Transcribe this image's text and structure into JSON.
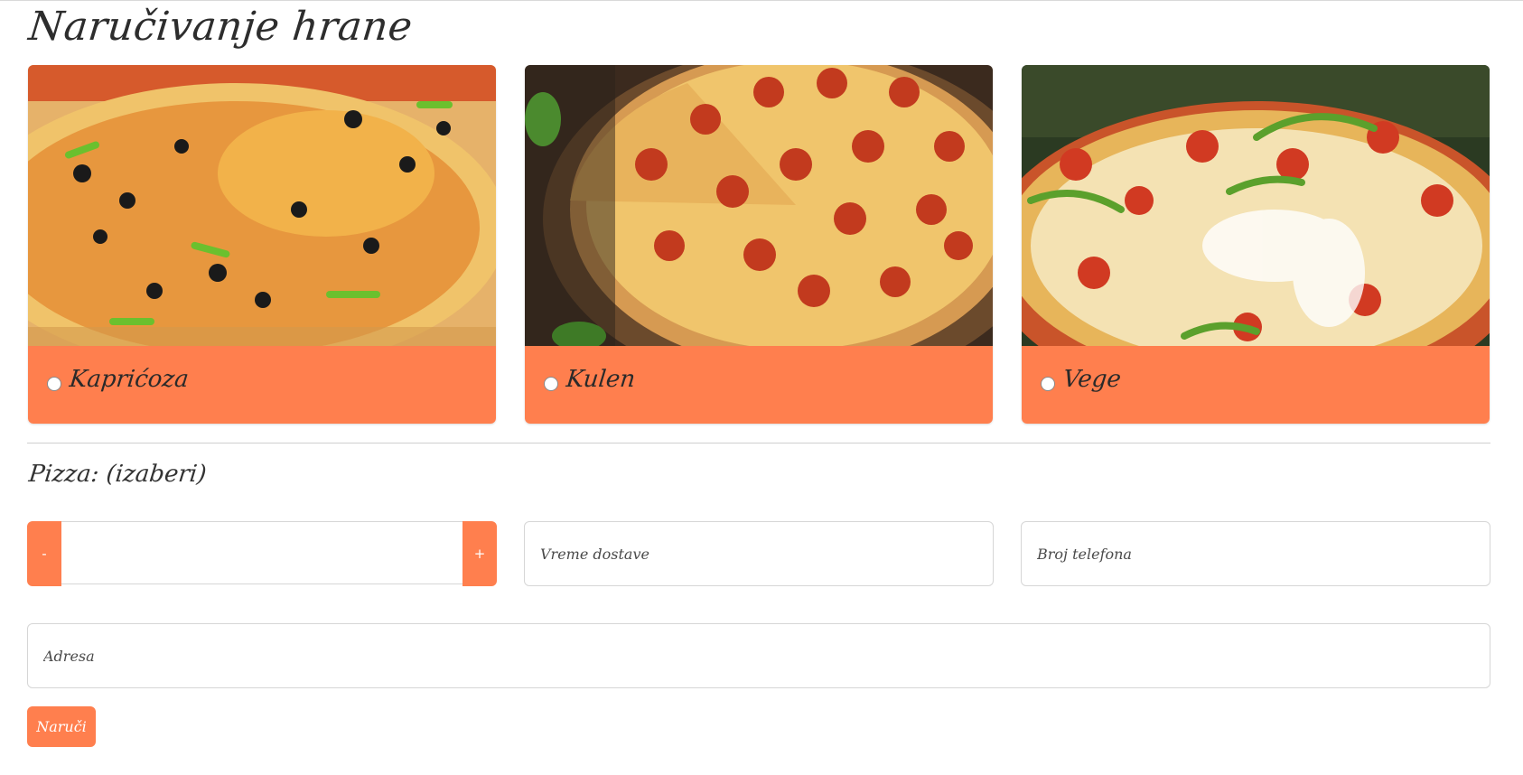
{
  "page": {
    "title": "Naručivanje hrane"
  },
  "pizzas": [
    {
      "label": "Kaprićoza",
      "image": "pizza-capricciosa-photo"
    },
    {
      "label": "Kulen",
      "image": "pizza-pepperoni-photo"
    },
    {
      "label": "Vege",
      "image": "pizza-vegetarian-photo"
    }
  ],
  "order": {
    "selected_text": "Pizza: (izaberi)",
    "quantity_value": "",
    "minus_label": "-",
    "plus_label": "+",
    "delivery_placeholder": "Vreme dostave",
    "phone_placeholder": "Broj telefona",
    "address_placeholder": "Adresa",
    "submit_label": "Naruči"
  },
  "colors": {
    "accent": "#ff7f4e",
    "border": "#d6d6d6"
  }
}
